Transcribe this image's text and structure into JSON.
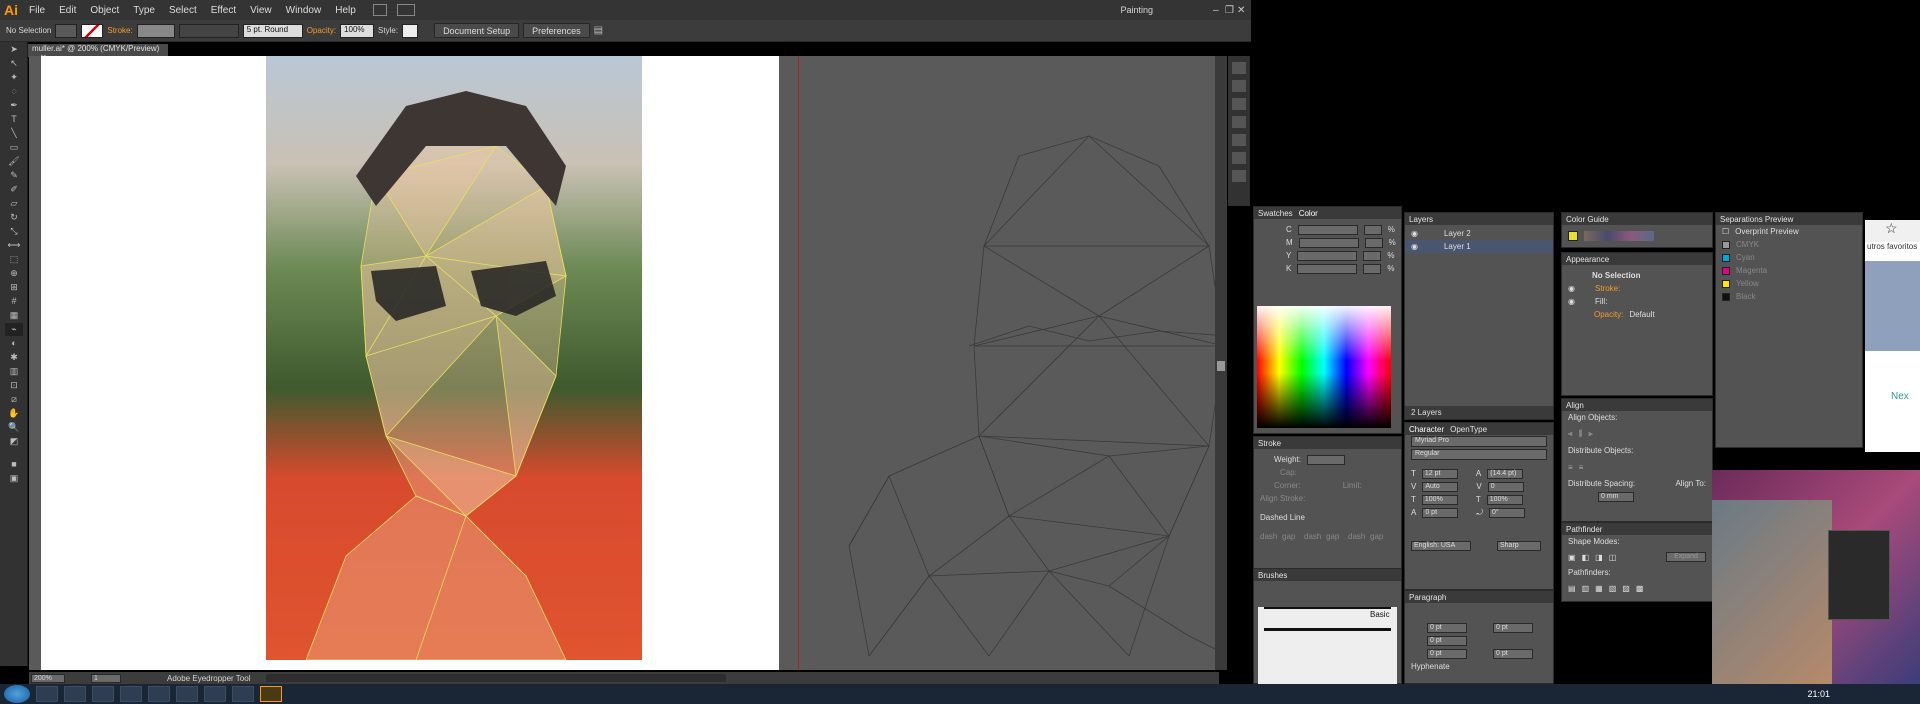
{
  "app": {
    "logo": "Ai",
    "workspace": "Painting"
  },
  "menu": [
    "File",
    "Edit",
    "Object",
    "Type",
    "Select",
    "Effect",
    "View",
    "Window",
    "Help"
  ],
  "control_bar": {
    "selection": "No Selection",
    "stroke_label": "Stroke:",
    "brush": "5 pt. Round",
    "opacity_label": "Opacity:",
    "opacity_value": "100%",
    "style_label": "Style:",
    "document_setup": "Document Setup",
    "preferences": "Preferences"
  },
  "document_tab": "muller.ai* @ 200% (CMYK/Preview)",
  "status": {
    "zoom": "200%",
    "page": "1",
    "tool": "Adobe Eyedropper Tool"
  },
  "clock": "21:01",
  "swatches_panel": {
    "tabs": [
      "Swatches",
      "Color"
    ],
    "channels": [
      "C",
      "M",
      "Y",
      "K"
    ],
    "unit": "%"
  },
  "stroke_panel": {
    "title": "Stroke",
    "weight_label": "Weight:",
    "cap_label": "Cap:",
    "corner_label": "Corner:",
    "limit_label": "Limit:",
    "align_label": "Align Stroke:",
    "dashed_label": "Dashed Line",
    "dash_cells": [
      "dash",
      "gap",
      "dash",
      "gap",
      "dash",
      "gap"
    ]
  },
  "brushes_panel": {
    "title": "Brushes",
    "basic_label": "Basic"
  },
  "layers_panel": {
    "title": "Layers",
    "layers": [
      "Layer 2",
      "Layer 1"
    ],
    "count": "2 Layers"
  },
  "character_panel": {
    "tabs": [
      "Character",
      "OpenType"
    ],
    "font": "Myriad Pro",
    "style": "Regular",
    "size": "12 pt",
    "leading": "(14.4 pt)",
    "kerning": "Auto",
    "tracking": "0",
    "vscale": "100%",
    "hscale": "100%",
    "baseline": "0 pt",
    "rotation": "0°",
    "language": "English: USA",
    "aa": "Sharp"
  },
  "paragraph_panel": {
    "title": "Paragraph",
    "indent_left": "0 pt",
    "indent_right": "0 pt",
    "indent_first": "0 pt",
    "space_before": "0 pt",
    "space_after": "0 pt",
    "hyphenate": "Hyphenate"
  },
  "color_guide_panel": {
    "title": "Color Guide"
  },
  "appearance_panel": {
    "title": "Appearance",
    "object": "No Selection",
    "stroke_label": "Stroke:",
    "fill_label": "Fill:",
    "opacity_label": "Opacity:",
    "opacity_value": "Default"
  },
  "align_panel": {
    "title": "Align",
    "align_objects": "Align Objects:",
    "distribute_objects": "Distribute Objects:",
    "distribute_spacing": "Distribute Spacing:",
    "spacing_value": "0 mm",
    "align_to": "Align To:"
  },
  "pathfinder_panel": {
    "title": "Pathfinder",
    "shape_modes": "Shape Modes:",
    "expand": "Expand",
    "pathfinders": "Pathfinders:"
  },
  "separations_panel": {
    "title": "Separations Preview",
    "overprint": "Overprint Preview",
    "inks": [
      {
        "name": "CMYK",
        "color": "#999999"
      },
      {
        "name": "Cyan",
        "color": "#00a8e0"
      },
      {
        "name": "Magenta",
        "color": "#e0008a"
      },
      {
        "name": "Yellow",
        "color": "#ffe600"
      },
      {
        "name": "Black",
        "color": "#111111"
      }
    ]
  },
  "browser": {
    "bookmarks": "utros favoritos",
    "next": "Nex"
  }
}
